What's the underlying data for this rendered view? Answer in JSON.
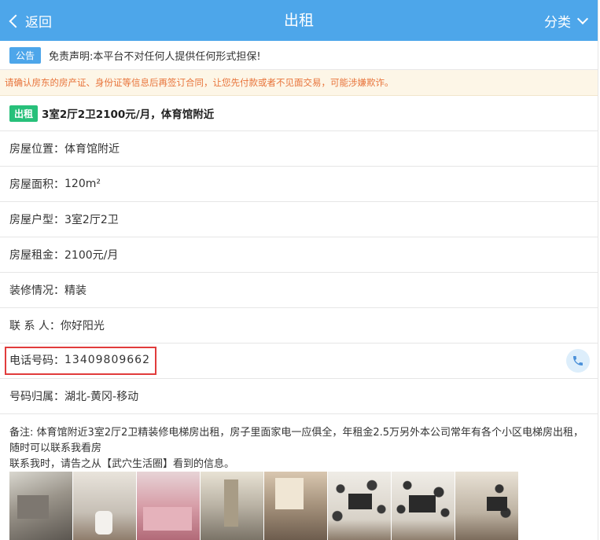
{
  "header": {
    "back_label": "返回",
    "title": "出租",
    "category_label": "分类"
  },
  "notice": {
    "badge": "公告",
    "text": "免责声明:本平台不对任何人提供任何形式担保!"
  },
  "warning": {
    "text": "请确认房东的房产证、身份证等信息后再签订合同，让您先付款或者不见面交易，可能涉嫌欺诈。"
  },
  "listing": {
    "badge": "出租",
    "title": "3室2厅2卫2100元/月，体育馆附近"
  },
  "details": [
    {
      "label": "房屋位置：",
      "value": "体育馆附近"
    },
    {
      "label": "房屋面积：",
      "value": "120m²"
    },
    {
      "label": "房屋户型：",
      "value": "3室2厅2卫"
    },
    {
      "label": "房屋租金：",
      "value": "2100元/月"
    },
    {
      "label": "装修情况：",
      "value": "精装"
    },
    {
      "label": "联 系 人：",
      "value": "你好阳光"
    },
    {
      "label": "电话号码：",
      "value": "13409809662"
    },
    {
      "label": "号码归属：",
      "value": "湖北-黄冈-移动"
    }
  ],
  "notes": {
    "line1": "备注: 体育馆附近3室2厅2卫精装修电梯房出租，房子里面家电一应俱全，年租金2.5万另外本公司常年有各个小区电梯房出租，随时可以联系我看房",
    "line2": "联系我时，请告之从【武穴生活圈】看到的信息。"
  },
  "colors": {
    "header": "#4da6ea",
    "rent_badge": "#27c07a",
    "warning_text": "#e8743b",
    "highlight_border": "#e13c3c"
  },
  "icons": {
    "back": "chevron-left-icon",
    "category": "chevron-down-icon",
    "call": "phone-icon"
  }
}
